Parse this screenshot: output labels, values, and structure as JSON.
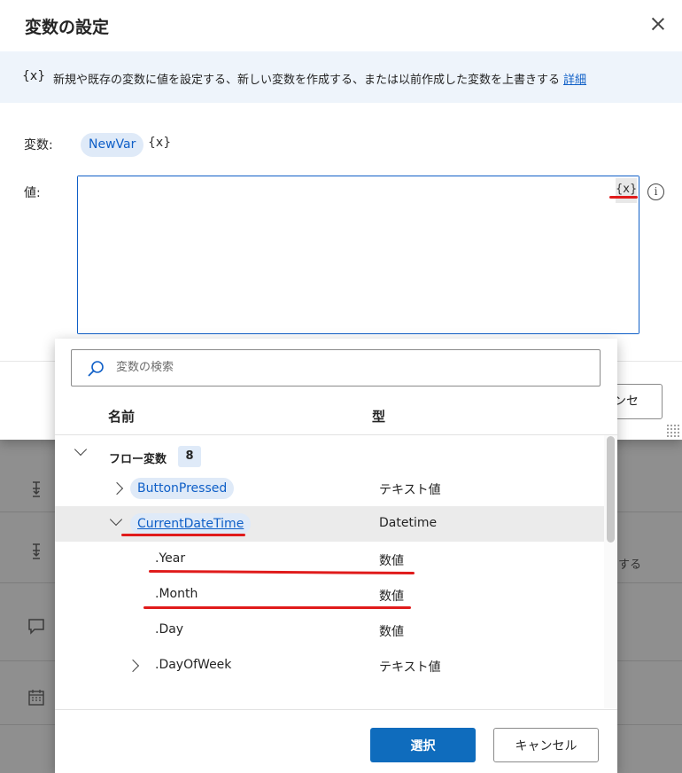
{
  "dialog": {
    "title": "変数の設定",
    "info_icon": "{x}",
    "info_text": "新規や既存の変数に値を設定する、新しい変数を作成する、または以前作成した変数を上書きする",
    "info_link": "詳細",
    "variable_label": "変数:",
    "variable_name": "NewVar",
    "variable_marker": "{x}",
    "value_label": "値:",
    "insert_var_icon": "{x}",
    "info_circle": "i",
    "cancel_behind": "キャンセル"
  },
  "background": {
    "partial_text": "する"
  },
  "picker": {
    "search_placeholder": "変数の検索",
    "col_name": "名前",
    "col_type": "型",
    "group": {
      "label": "フロー変数",
      "count": "8"
    },
    "variables": [
      {
        "name": "ButtonPressed",
        "type": "テキスト値",
        "expanded": false
      },
      {
        "name": "CurrentDateTime",
        "type": "Datetime",
        "expanded": true
      }
    ],
    "properties": [
      {
        "name": ".Year",
        "type": "数値"
      },
      {
        "name": ".Month",
        "type": "数値"
      },
      {
        "name": ".Day",
        "type": "数値"
      },
      {
        "name": ".DayOfWeek",
        "type": "テキスト値"
      }
    ],
    "select_label": "選択",
    "cancel_label": "キャンセル"
  },
  "colors": {
    "accent": "#0f6cbd",
    "chip_bg": "#dfeaf8",
    "annotation_red": "#e01b1b"
  }
}
